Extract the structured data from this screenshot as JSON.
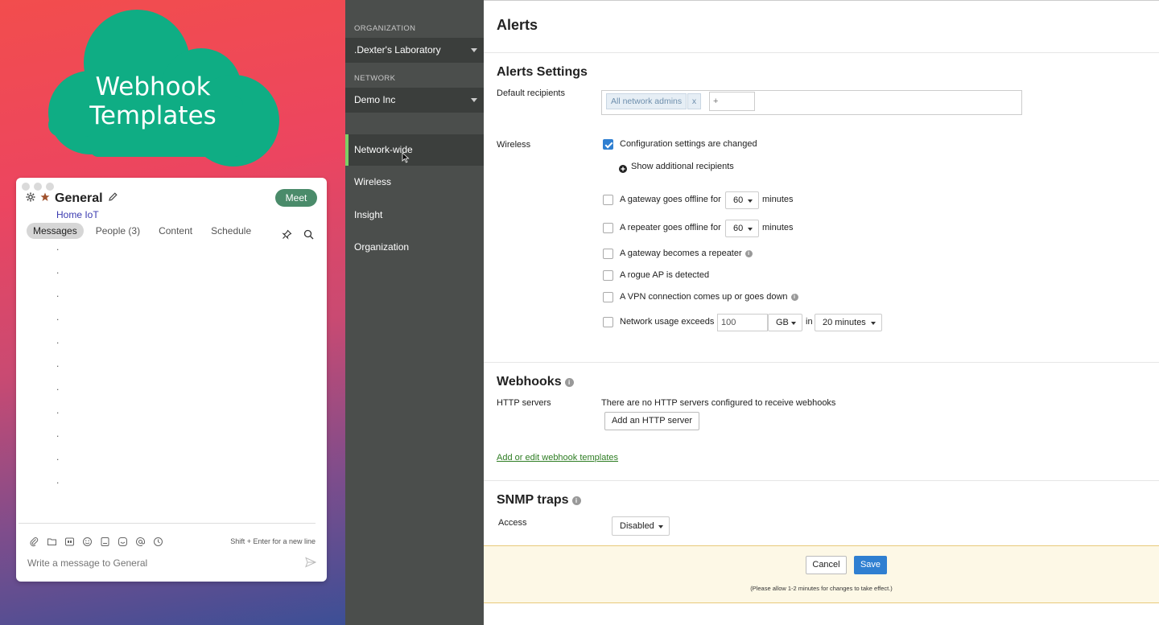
{
  "overlay": {
    "title_line1": "Webhook",
    "title_line2": "Templates",
    "cloud_color": "#0fad84"
  },
  "chat": {
    "title": "General",
    "subtitle": "Home IoT",
    "meet_label": "Meet",
    "tabs": [
      {
        "label": "Messages",
        "active": true
      },
      {
        "label": "People (3)",
        "active": false
      },
      {
        "label": "Content",
        "active": false
      },
      {
        "label": "Schedule",
        "active": false
      }
    ],
    "messages": [
      ".",
      ".",
      ".",
      ".",
      ".",
      ".",
      ".",
      ".",
      ".",
      ".",
      "."
    ],
    "hint": "Shift + Enter for a new line",
    "input_placeholder": "Write a message to General"
  },
  "nav": {
    "org_label": "ORGANIZATION",
    "org_value": ".Dexter's Laboratory",
    "network_label": "NETWORK",
    "network_value": "Demo Inc",
    "items": [
      {
        "label": "Network-wide",
        "active": true
      },
      {
        "label": "Wireless",
        "active": false
      },
      {
        "label": "Insight",
        "active": false
      },
      {
        "label": "Organization",
        "active": false
      }
    ]
  },
  "main": {
    "title": "Alerts",
    "alerts_settings": {
      "title": "Alerts Settings",
      "default_recipients_label": "Default recipients",
      "recipient_chip": "All network admins",
      "recipient_chip_remove": "x",
      "recipient_input_placeholder": "+",
      "wireless_label": "Wireless",
      "config_changed": "Configuration settings are changed",
      "show_additional": "Show additional recipients",
      "gateway_offline_prefix": "A gateway goes offline for",
      "gateway_offline_value": "60",
      "gateway_offline_suffix": "minutes",
      "repeater_offline_prefix": "A repeater goes offline for",
      "repeater_offline_value": "60",
      "repeater_offline_suffix": "minutes",
      "gateway_repeater": "A gateway becomes a repeater",
      "rogue_ap": "A rogue AP is detected",
      "vpn": "A VPN connection comes up or goes down",
      "usage_prefix": "Network usage exceeds",
      "usage_value": "100",
      "usage_unit": "GB",
      "usage_in": "in",
      "usage_period": "20 minutes"
    },
    "webhooks": {
      "title": "Webhooks",
      "http_label": "HTTP servers",
      "http_none": "There are no HTTP servers configured to receive webhooks",
      "add_button": "Add an HTTP server",
      "templates_link": "Add or edit webhook templates"
    },
    "snmp": {
      "title": "SNMP traps",
      "access_label": "Access",
      "access_value": "Disabled"
    },
    "footer": {
      "cancel": "Cancel",
      "save": "Save",
      "note": "(Please allow 1-2 minutes for changes to take effect.)"
    }
  }
}
